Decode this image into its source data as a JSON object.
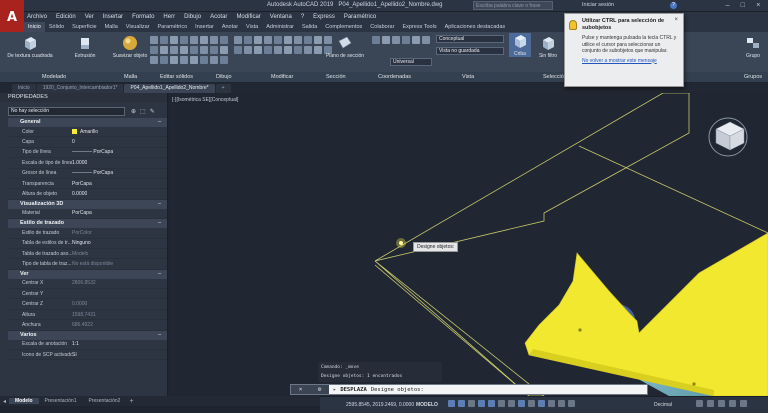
{
  "title": {
    "app": "Autodesk AutoCAD 2019",
    "file": "P04_Apellido1_Apellido2_Nombre.dwg",
    "search_placeholder": "Escriba palabra clave o frase",
    "signin": "Iniciar sesión"
  },
  "menu": [
    "Archivo",
    "Edición",
    "Ver",
    "Insertar",
    "Formato",
    "Herr",
    "Dibujo",
    "Acotar",
    "Modificar",
    "Ventana",
    "?",
    "Express",
    "Paramétrico"
  ],
  "ribbon_tabs": [
    "Inicio",
    "Sólido",
    "Superficie",
    "Malla",
    "Visualizar",
    "Paramétrico",
    "Insertar",
    "Anotar",
    "Vista",
    "Administrar",
    "Salida",
    "Complementos",
    "Colaborar",
    "Express Tools",
    "Aplicaciones destacadas"
  ],
  "ribbon": {
    "btn_caja": "De textura cuadrada",
    "btn_extrusion": "Extrusión",
    "btn_suavizar": "Suavizar objeto",
    "btn_plano": "Plano de sección",
    "btn_criba": "Criba",
    "btn_sinfiltro": "Sin filtro",
    "btn_grupo": "Grupo",
    "dd_visual": "Conceptual",
    "dd_vista": "Vista no guardada",
    "dd_scp": "Universal",
    "dd_sel": "Sin filtro",
    "panels": [
      "Modelado",
      "Malla",
      "Editar sólidos",
      "Dibujo",
      "Modificar",
      "Sección",
      "Coordenadas",
      "Vista",
      "Selección",
      "Grupos"
    ]
  },
  "file_tabs": [
    "Inicio",
    "1920_Conjunto_Intercambiador1*",
    "P04_Apellido1_Apellido2_Nombre*"
  ],
  "properties": {
    "title": "PROPIEDADES",
    "selection": "No hay selección",
    "sections": [
      {
        "name": "General",
        "rows": [
          {
            "k": "Color",
            "v": "Amarillo",
            "swatch": "#f7ec3c"
          },
          {
            "k": "Capa",
            "v": "0"
          },
          {
            "k": "Tipo de línea",
            "v": "———— PorCapa"
          },
          {
            "k": "Escala de tipo de línea",
            "v": "1.0000"
          },
          {
            "k": "Grosor de línea",
            "v": "———— PorCapa"
          },
          {
            "k": "Transparencia",
            "v": "PorCapa"
          },
          {
            "k": "Altura de objeto",
            "v": "0.0000"
          }
        ]
      },
      {
        "name": "Visualización 3D",
        "rows": [
          {
            "k": "Material",
            "v": "PorCapa"
          }
        ]
      },
      {
        "name": "Estilo de trazado",
        "rows": [
          {
            "k": "Estilo de trazado",
            "v": "PorColor",
            "dim": true
          },
          {
            "k": "Tabla de estilos de tr...",
            "v": "Ninguno"
          },
          {
            "k": "Tabla de trazado aso...",
            "v": "Modelo",
            "dim": true
          },
          {
            "k": "Tipo de tabla de traz...",
            "v": "No está disponible",
            "dim": true
          }
        ]
      },
      {
        "name": "Ver",
        "rows": [
          {
            "k": "Centrar X",
            "v": "2806.8532",
            "dim": true
          },
          {
            "k": "Centrar Y",
            "v": ""
          },
          {
            "k": "Centrar Z",
            "v": "0.0000",
            "dim": true
          },
          {
            "k": "Altura",
            "v": "1598.7431",
            "dim": true
          },
          {
            "k": "Anchura",
            "v": "686.4922",
            "dim": true
          }
        ]
      },
      {
        "name": "Varios",
        "rows": [
          {
            "k": "Escala de anotación",
            "v": "1:1"
          },
          {
            "k": "Icono de SCP activado",
            "v": "Sí"
          }
        ]
      }
    ]
  },
  "viewport": {
    "label": "[-][Isométrica SE][Conceptual]",
    "tooltip": "Designe objetos:"
  },
  "command": {
    "history": [
      "Comando: _move",
      "Designe objetos: 1 encontrados"
    ],
    "prompt_cmd": "DESPLAZA",
    "prompt": "Designe objetos:"
  },
  "layout_tabs": [
    "Modelo",
    "Presentación1",
    "Presentación2"
  ],
  "status": {
    "coords": "2595.8545, 2619.2469, 0.0000",
    "mode": "MODELO",
    "units": "Decimal"
  },
  "notice": {
    "title": "Utilizar CTRL para selección de subobjetos",
    "body": "Pulse y mantenga pulsada la tecla CTRL y utilice el cursor para seleccionar un conjunto de subobjetos que manipular.",
    "link": "No volver a mostrar este mensaje"
  },
  "colors": {
    "accent": "#a8231d",
    "model_yellow": "#f7ec3c",
    "wire": "#c8c86a"
  }
}
